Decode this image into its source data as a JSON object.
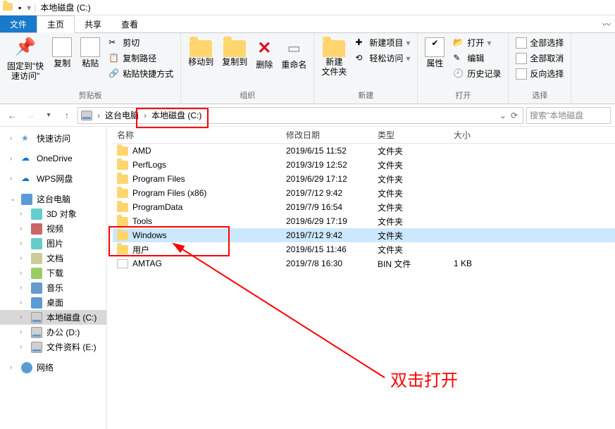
{
  "titlebar": {
    "title": "本地磁盘 (C:)"
  },
  "tabs": {
    "file": "文件",
    "home": "主页",
    "share": "共享",
    "view": "查看"
  },
  "ribbon": {
    "pin": "固定到\"快\n速访问\"",
    "copy": "复制",
    "paste": "粘贴",
    "cut": "剪切",
    "copy_path": "复制路径",
    "paste_shortcut": "粘贴快捷方式",
    "group_clipboard": "剪贴板",
    "move_to": "移动到",
    "copy_to": "复制到",
    "delete": "删除",
    "rename": "重命名",
    "group_organize": "组织",
    "new_folder": "新建\n文件夹",
    "new_item": "新建项目",
    "easy_access": "轻松访问",
    "group_new": "新建",
    "properties": "属性",
    "open": "打开",
    "edit": "编辑",
    "history": "历史记录",
    "group_open": "打开",
    "select_all": "全部选择",
    "select_none": "全部取消",
    "invert": "反向选择",
    "group_select": "选择"
  },
  "nav": {
    "this_pc": "这台电脑",
    "local_disk": "本地磁盘 (C:)",
    "search_placeholder": "搜索\"本地磁盘"
  },
  "tree": {
    "quick_access": "快速访问",
    "onedrive": "OneDrive",
    "wps": "WPS网盘",
    "this_pc": "这台电脑",
    "pc_children": [
      {
        "label": "3D 对象",
        "color": "#6cc"
      },
      {
        "label": "视频",
        "color": "#c66"
      },
      {
        "label": "图片",
        "color": "#6cc"
      },
      {
        "label": "文档",
        "color": "#cc9"
      },
      {
        "label": "下载",
        "color": "#9c6"
      },
      {
        "label": "音乐",
        "color": "#69c"
      },
      {
        "label": "桌面",
        "color": "#5b9bd5"
      }
    ],
    "disk_c": "本地磁盘 (C:)",
    "disk_d": "办公 (D:)",
    "disk_e": "文件资料 (E:)",
    "network": "网络"
  },
  "columns": {
    "name": "名称",
    "date": "修改日期",
    "type": "类型",
    "size": "大小"
  },
  "files": [
    {
      "name": "AMD",
      "date": "2019/6/15 11:52",
      "type": "文件夹",
      "size": "",
      "icon": "folder"
    },
    {
      "name": "PerfLogs",
      "date": "2019/3/19 12:52",
      "type": "文件夹",
      "size": "",
      "icon": "folder"
    },
    {
      "name": "Program Files",
      "date": "2019/6/29 17:12",
      "type": "文件夹",
      "size": "",
      "icon": "folder"
    },
    {
      "name": "Program Files (x86)",
      "date": "2019/7/12 9:42",
      "type": "文件夹",
      "size": "",
      "icon": "folder"
    },
    {
      "name": "ProgramData",
      "date": "2019/7/9 16:54",
      "type": "文件夹",
      "size": "",
      "icon": "folder"
    },
    {
      "name": "Tools",
      "date": "2019/6/29 17:19",
      "type": "文件夹",
      "size": "",
      "icon": "folder"
    },
    {
      "name": "Windows",
      "date": "2019/7/12 9:42",
      "type": "文件夹",
      "size": "",
      "icon": "folder",
      "selected": true
    },
    {
      "name": "用户",
      "date": "2019/6/15 11:46",
      "type": "文件夹",
      "size": "",
      "icon": "folder"
    },
    {
      "name": "AMTAG",
      "date": "2019/7/8 16:30",
      "type": "BIN 文件",
      "size": "1 KB",
      "icon": "file"
    }
  ],
  "annotation": {
    "label": "双击打开"
  }
}
